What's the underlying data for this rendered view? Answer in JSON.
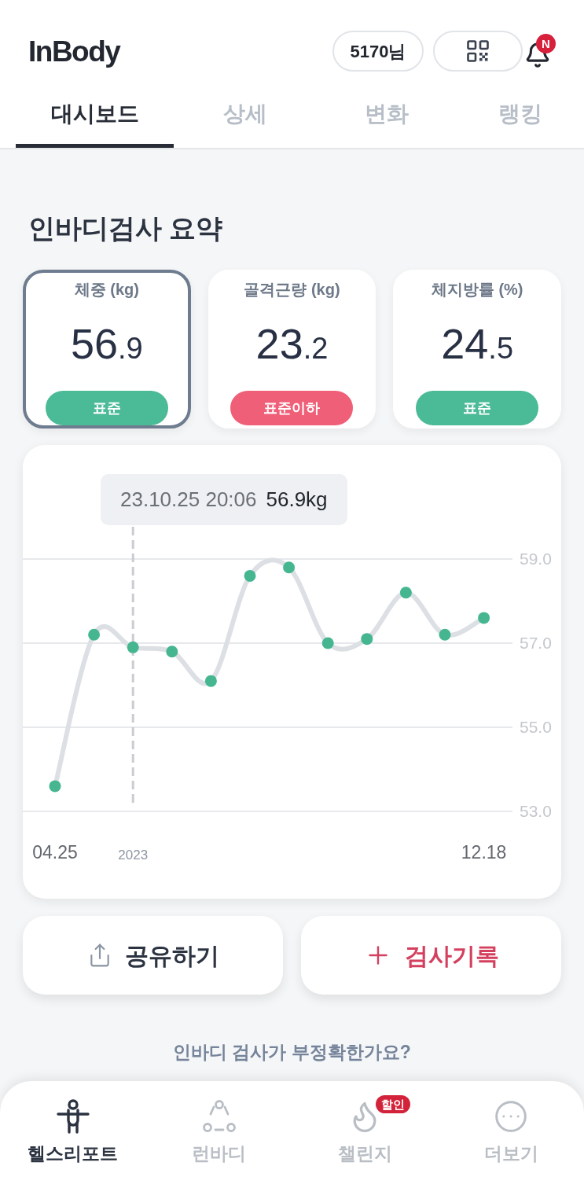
{
  "header": {
    "logo": "InBody",
    "user_button": "5170님",
    "notification_badge": "N"
  },
  "tabs": [
    {
      "label": "대시보드",
      "selected": true
    },
    {
      "label": "상세",
      "selected": false
    },
    {
      "label": "변화",
      "selected": false
    },
    {
      "label": "랭킹",
      "selected": false
    }
  ],
  "summary": {
    "title": "인바디검사 요약",
    "cards": [
      {
        "title": "체중 (kg)",
        "value_main": "56",
        "value_fraction": ".9",
        "status": {
          "label": "표준",
          "color": "#4bba96"
        },
        "selected": true
      },
      {
        "title": "골격근량 (kg)",
        "value_main": "23",
        "value_fraction": ".2",
        "status": {
          "label": "표준이하",
          "color": "#f05f78"
        },
        "selected": false
      },
      {
        "title": "체지방률 (%)",
        "value_main": "24",
        "value_fraction": ".5",
        "status": {
          "label": "표준",
          "color": "#4bba96"
        },
        "selected": false
      }
    ]
  },
  "chart": {
    "tooltip": {
      "datetime": "23.10.25 20:06",
      "value": "56.9kg"
    },
    "chart_data": {
      "type": "line",
      "categories": [
        "04.25",
        null,
        "2023",
        null,
        null,
        null,
        null,
        null,
        null,
        null,
        null,
        "12.18"
      ],
      "series": [
        {
          "color": "#45b68f",
          "marker": "circle",
          "values": [
            53.6,
            57.2,
            56.9,
            56.8,
            56.1,
            58.6,
            58.8,
            57.0,
            57.1,
            58.2,
            57.2,
            57.6
          ]
        }
      ],
      "ylim": [
        53,
        59
      ],
      "yticks": [
        {
          "value": 53,
          "label": "53.0"
        },
        {
          "value": 55,
          "label": "55.0"
        },
        {
          "value": 57,
          "label": "57.0"
        },
        {
          "value": 59,
          "label": "59.0"
        }
      ]
    }
  },
  "actions": [
    {
      "label": "공유하기",
      "kind": "share"
    },
    {
      "label": "검사기록",
      "kind": "add"
    }
  ],
  "notice": "인바디 검사가 부정확한가요?",
  "bottom_nav": [
    {
      "label": "헬스리포트",
      "selected": true
    },
    {
      "label": "런바디",
      "selected": false
    },
    {
      "label": "챌린지",
      "selected": false,
      "badge": "할인"
    },
    {
      "label": "더보기",
      "selected": false
    }
  ]
}
